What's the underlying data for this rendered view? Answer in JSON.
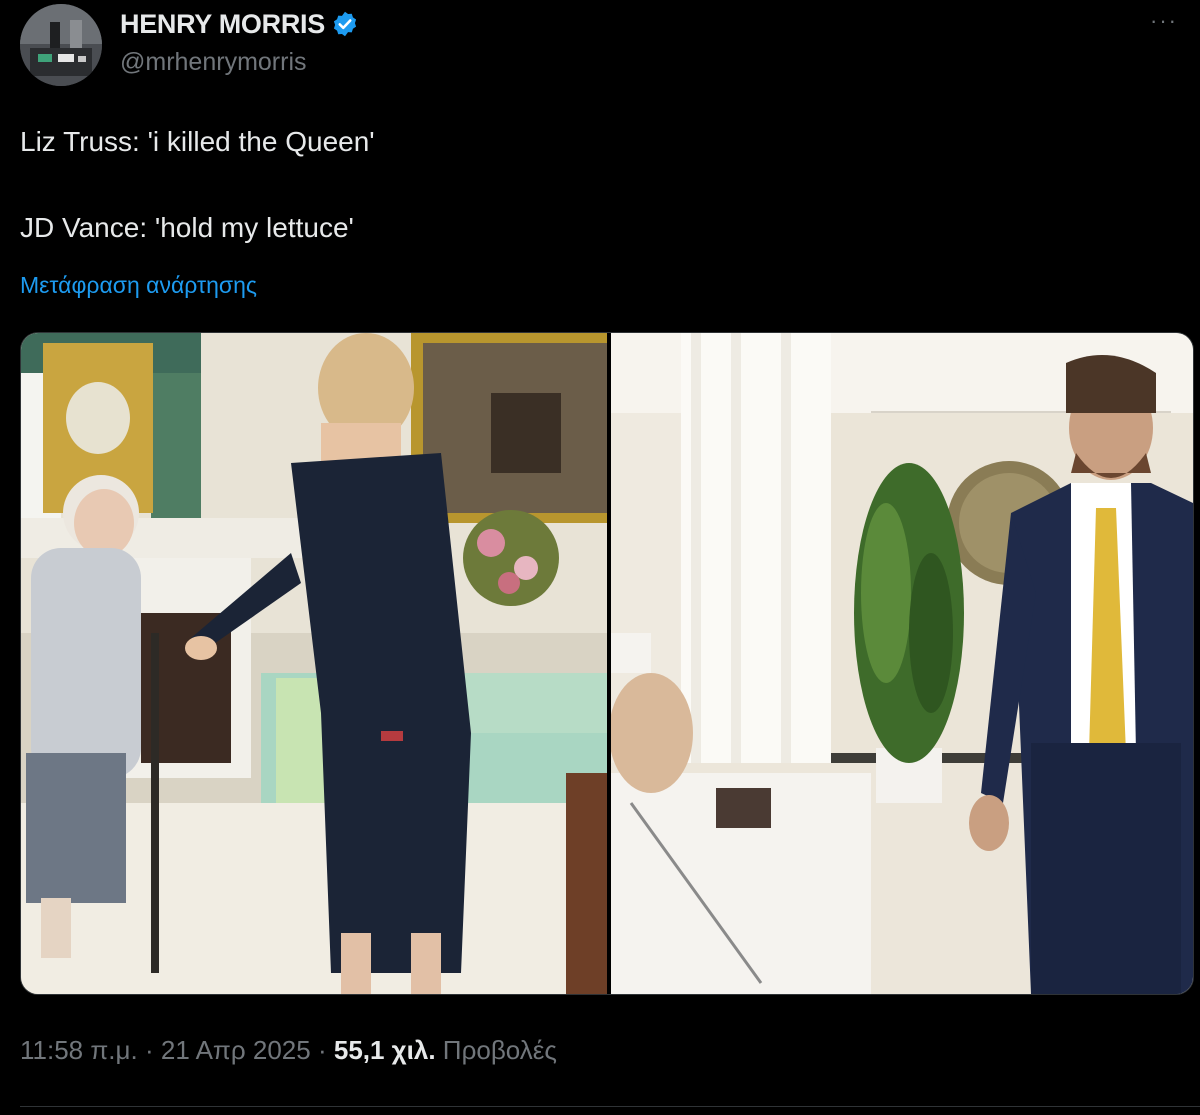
{
  "author": {
    "display_name": "HENRY MORRIS",
    "handle": "@mrhenrymorris",
    "verified": true,
    "avatar_icon": "profile-photo"
  },
  "tweet": {
    "lines": [
      "Liz Truss: 'i killed the Queen'",
      "",
      "JD Vance: 'hold my lettuce'"
    ],
    "translate_label": "Μετάφραση ανάρτησης"
  },
  "media": {
    "count": 2,
    "photos": [
      "photo-left",
      "photo-right"
    ]
  },
  "meta": {
    "time": "11:58 π.μ.",
    "separator": "·",
    "date": "21 Απρ 2025",
    "views_count": "55,1 χιλ.",
    "views_label": "Προβολές"
  },
  "menu_icon": "more-dots-icon",
  "colors": {
    "background": "#000000",
    "text": "#e7e9ea",
    "secondary": "#71767b",
    "link": "#1d9bf0",
    "verified": "#1d9bf0",
    "border": "#2f3336"
  }
}
